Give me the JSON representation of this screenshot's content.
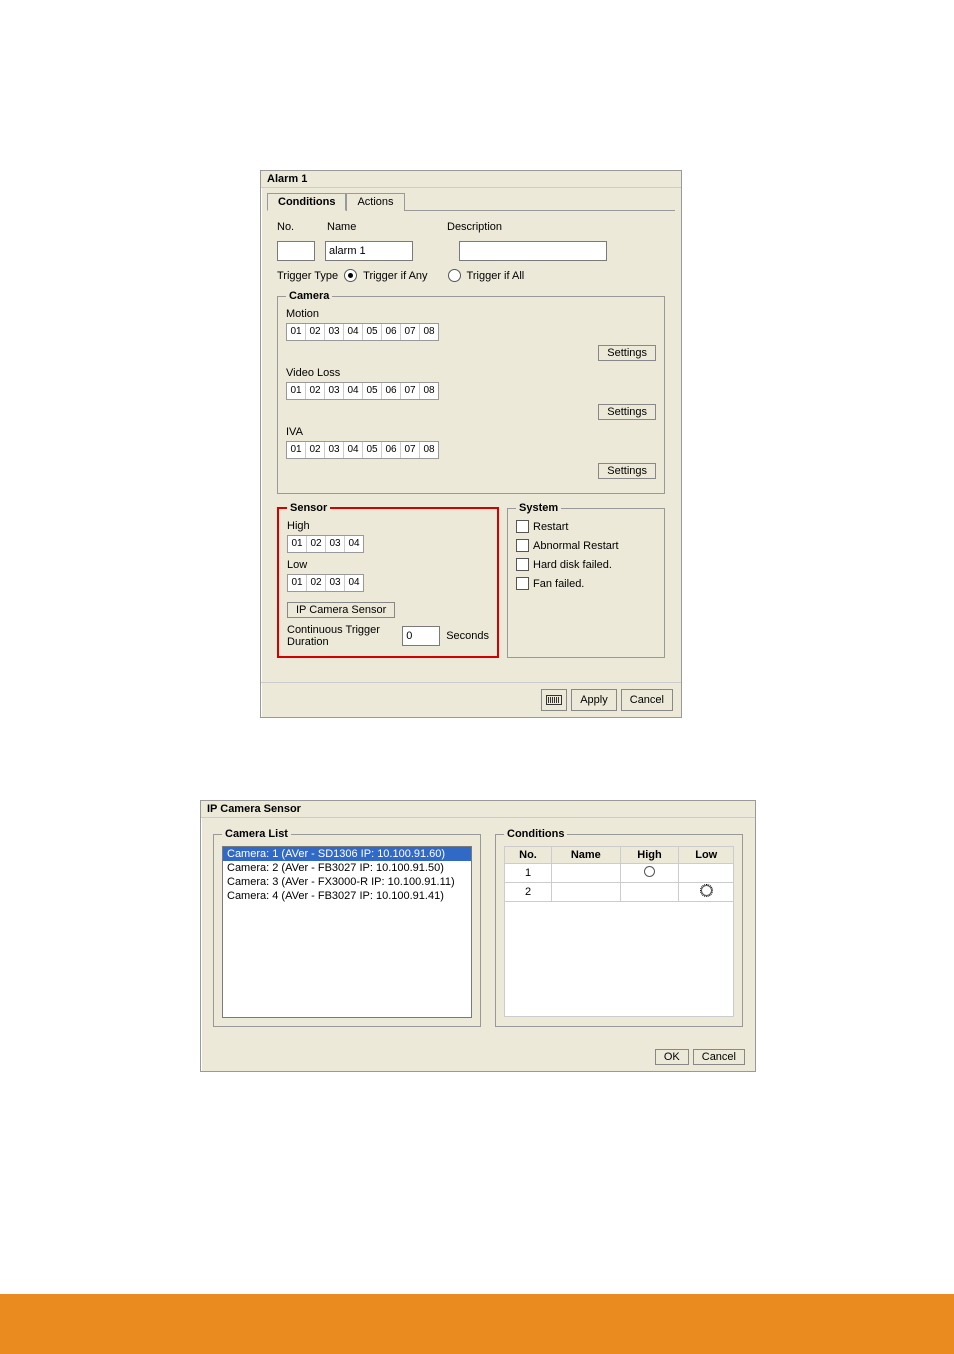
{
  "dialog1": {
    "title": "Alarm 1",
    "tabs": {
      "conditions": "Conditions",
      "actions": "Actions"
    },
    "labels": {
      "no": "No.",
      "name": "Name",
      "description": "Description",
      "trigger_type": "Trigger Type",
      "trigger_if_any": "Trigger if Any",
      "trigger_if_all": "Trigger if All",
      "settings": "Settings"
    },
    "values": {
      "no": "",
      "name": "alarm 1",
      "description": ""
    },
    "camera": {
      "legend": "Camera",
      "motion_label": "Motion",
      "video_loss_label": "Video Loss",
      "iva_label": "IVA",
      "nums": [
        "01",
        "02",
        "03",
        "04",
        "05",
        "06",
        "07",
        "08"
      ]
    },
    "sensor": {
      "legend": "Sensor",
      "high_label": "High",
      "low_label": "Low",
      "nums": [
        "01",
        "02",
        "03",
        "04"
      ],
      "ip_camera_sensor_btn": "IP Camera Sensor",
      "ctd_label": "Continuous Trigger Duration",
      "ctd_value": "0",
      "seconds": "Seconds"
    },
    "system": {
      "legend": "System",
      "items": [
        "Restart",
        "Abnormal Restart",
        "Hard disk failed.",
        "Fan failed."
      ]
    },
    "footer": {
      "apply": "Apply",
      "cancel": "Cancel"
    }
  },
  "dialog2": {
    "title": "IP Camera Sensor",
    "camera_list": {
      "legend": "Camera List",
      "items": [
        "Camera: 1 (AVer - SD1306 IP: 10.100.91.60)",
        "Camera: 2 (AVer - FB3027 IP: 10.100.91.50)",
        "Camera: 3 (AVer - FX3000-R IP: 10.100.91.11)",
        "Camera: 4 (AVer - FB3027 IP: 10.100.91.41)"
      ]
    },
    "conditions": {
      "legend": "Conditions",
      "headers": {
        "no": "No.",
        "name": "Name",
        "high": "High",
        "low": "Low"
      },
      "rows": [
        {
          "no": "1",
          "name": "",
          "high": true,
          "low": false
        },
        {
          "no": "2",
          "name": "",
          "high": false,
          "low": true
        }
      ]
    },
    "footer": {
      "ok": "OK",
      "cancel": "Cancel"
    }
  }
}
